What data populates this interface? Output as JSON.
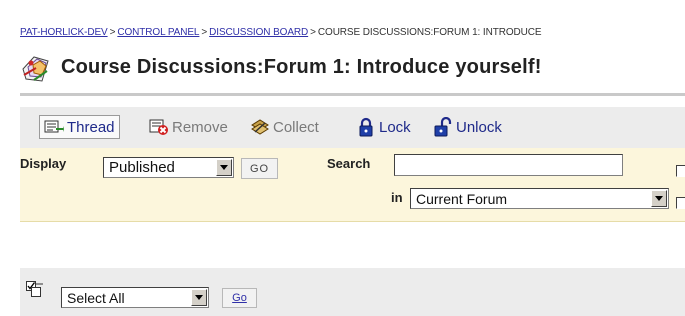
{
  "breadcrumb": {
    "items": [
      "PAT-HORLICK-DEV",
      "CONTROL PANEL",
      "DISCUSSION BOARD"
    ],
    "current": "COURSE DISCUSSIONS:FORUM 1: INTRODUCE",
    "separator": ">"
  },
  "page_title": "Course Discussions:Forum 1: Introduce yourself!",
  "toolbar": {
    "thread": "Thread",
    "remove": "Remove",
    "collect": "Collect",
    "lock": "Lock",
    "unlock": "Unlock"
  },
  "filters": {
    "display_label": "Display",
    "display_value": "Published",
    "go_label": "GO",
    "search_label": "Search",
    "search_value": "",
    "in_label": "in",
    "in_value": "Current Forum"
  },
  "bulk": {
    "select_value": "Select All",
    "go_label": "Go"
  },
  "colors": {
    "link": "#3030a8",
    "toolbar_bg": "#ececec",
    "panel_bg": "#fcf6dc"
  }
}
